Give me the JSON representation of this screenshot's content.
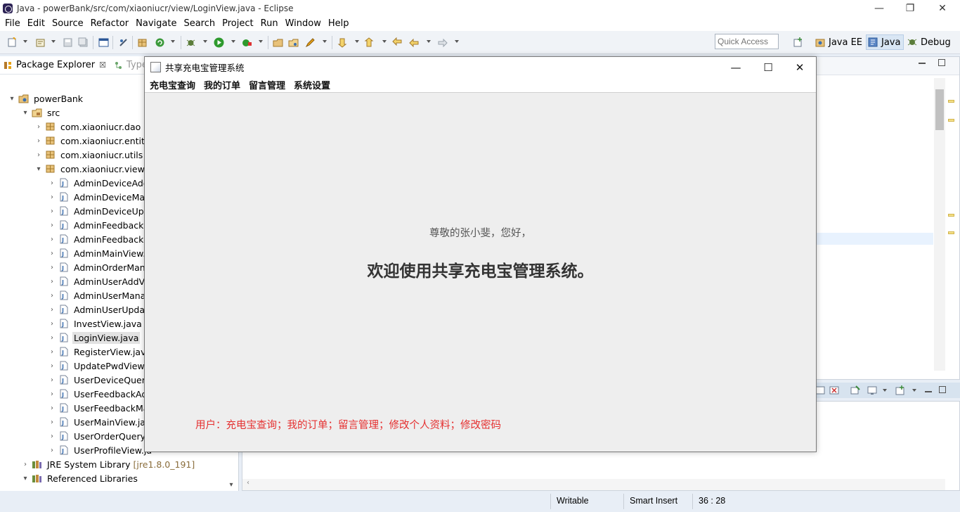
{
  "window": {
    "title": "Java - powerBank/src/com/xiaoniucr/view/LoginView.java - Eclipse",
    "controls": {
      "minimize": "—",
      "restore": "❐",
      "close": "✕"
    }
  },
  "menubar": [
    "File",
    "Edit",
    "Source",
    "Refactor",
    "Navigate",
    "Search",
    "Project",
    "Run",
    "Window",
    "Help"
  ],
  "toolbar": {
    "quick_access_placeholder": "Quick Access",
    "perspectives": [
      {
        "label": "Java EE",
        "active": false
      },
      {
        "label": "Java",
        "active": true
      },
      {
        "label": "Debug",
        "active": false
      }
    ]
  },
  "package_explorer": {
    "tab_label": "Package Explorer",
    "tab_close": "☒",
    "second_tab_label": "Type",
    "tree": [
      {
        "label": "powerBank",
        "depth": 0,
        "arrow": "▾",
        "kind": "project"
      },
      {
        "label": "src",
        "depth": 1,
        "arrow": "▾",
        "kind": "srcfolder"
      },
      {
        "label": "com.xiaoniucr.dao",
        "depth": 2,
        "arrow": "›",
        "kind": "package"
      },
      {
        "label": "com.xiaoniucr.entity",
        "depth": 2,
        "arrow": "›",
        "kind": "package"
      },
      {
        "label": "com.xiaoniucr.utils",
        "depth": 2,
        "arrow": "›",
        "kind": "package"
      },
      {
        "label": "com.xiaoniucr.view",
        "depth": 2,
        "arrow": "▾",
        "kind": "package"
      },
      {
        "label": "AdminDeviceAdd",
        "depth": 3,
        "arrow": "›",
        "kind": "java"
      },
      {
        "label": "AdminDeviceMan",
        "depth": 3,
        "arrow": "›",
        "kind": "java"
      },
      {
        "label": "AdminDeviceUpd",
        "depth": 3,
        "arrow": "›",
        "kind": "java"
      },
      {
        "label": "AdminFeedbackM",
        "depth": 3,
        "arrow": "›",
        "kind": "java"
      },
      {
        "label": "AdminFeedbackR",
        "depth": 3,
        "arrow": "›",
        "kind": "java"
      },
      {
        "label": "AdminMainView.j",
        "depth": 3,
        "arrow": "›",
        "kind": "java"
      },
      {
        "label": "AdminOrderMana",
        "depth": 3,
        "arrow": "›",
        "kind": "java"
      },
      {
        "label": "AdminUserAddVi",
        "depth": 3,
        "arrow": "›",
        "kind": "java"
      },
      {
        "label": "AdminUserManag",
        "depth": 3,
        "arrow": "›",
        "kind": "java"
      },
      {
        "label": "AdminUserUpdat",
        "depth": 3,
        "arrow": "›",
        "kind": "java"
      },
      {
        "label": "InvestView.java",
        "depth": 3,
        "arrow": "›",
        "kind": "java"
      },
      {
        "label": "LoginView.java",
        "depth": 3,
        "arrow": "›",
        "kind": "java",
        "selected": true
      },
      {
        "label": "RegisterView.java",
        "depth": 3,
        "arrow": "›",
        "kind": "java"
      },
      {
        "label": "UpdatePwdView.j",
        "depth": 3,
        "arrow": "›",
        "kind": "java"
      },
      {
        "label": "UserDeviceQuery",
        "depth": 3,
        "arrow": "›",
        "kind": "java"
      },
      {
        "label": "UserFeedbackAd",
        "depth": 3,
        "arrow": "›",
        "kind": "java"
      },
      {
        "label": "UserFeedbackMa",
        "depth": 3,
        "arrow": "›",
        "kind": "java"
      },
      {
        "label": "UserMainView.jav",
        "depth": 3,
        "arrow": "›",
        "kind": "java"
      },
      {
        "label": "UserOrderQuery\\",
        "depth": 3,
        "arrow": "›",
        "kind": "java"
      },
      {
        "label": "UserProfileView.ja",
        "depth": 3,
        "arrow": "›",
        "kind": "java"
      },
      {
        "label": "JRE System Library",
        "suffix": "[jre1.8.0_191]",
        "depth": 1,
        "arrow": "›",
        "kind": "library"
      },
      {
        "label": "Referenced Libraries",
        "depth": 1,
        "arrow": "▾",
        "kind": "library"
      }
    ]
  },
  "dialog": {
    "title": "共享充电宝管理系统",
    "menus": [
      "充电宝查询",
      "我的订单",
      "留言管理",
      "系统设置"
    ],
    "greeting": "尊敬的张小斐，您好，",
    "welcome": "欢迎使用共享充电宝管理系统。",
    "user_note": "用户：充电宝查询；我的订单；留言管理；修改个人资料；修改密码",
    "controls": {
      "minimize": "—",
      "maximize": "☐",
      "close": "✕"
    }
  },
  "statusbar": {
    "writable": "Writable",
    "insert_mode": "Smart Insert",
    "position": "36 : 28"
  },
  "colors": {
    "accent_red": "#e53030",
    "selection": "#e2e2e2",
    "active_perspective": "#d9e6f4"
  }
}
